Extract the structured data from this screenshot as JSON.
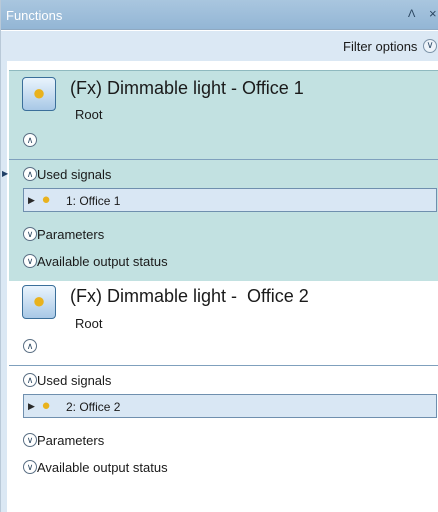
{
  "window": {
    "title": "Functions",
    "pin_glyph": "Ʌ",
    "close_glyph": "×"
  },
  "filter": {
    "label": "Filter options",
    "chevron": "∨"
  },
  "functions": [
    {
      "title": "(Fx) Dimmable light - Office 1",
      "root": "Root",
      "collapse_glyph": "∧",
      "used_signals_label": "Used signals",
      "used_signals_glyph": "∧",
      "signal": {
        "text": "1: Office 1",
        "icon": "lightbulb-icon"
      },
      "parameters_label": "Parameters",
      "parameters_glyph": "∨",
      "output_label": "Available output status",
      "output_glyph": "∨",
      "icon": "lightbulb-icon",
      "selected": true
    },
    {
      "title": "(Fx) Dimmable light -  Office 2",
      "root": "Root",
      "collapse_glyph": "∧",
      "used_signals_label": "Used signals",
      "used_signals_glyph": "∧",
      "signal": {
        "text": "2: Office 2",
        "icon": "lightbulb-icon"
      },
      "parameters_label": "Parameters",
      "parameters_glyph": "∨",
      "output_label": "Available output status",
      "output_glyph": "∨",
      "icon": "lightbulb-icon",
      "selected": false
    }
  ],
  "colors": {
    "selected_bg": "#c2e1e1",
    "titlebar": "#93b6d5",
    "signal_row_bg": "#d9e7f4",
    "bulb": "#e9b21d"
  }
}
